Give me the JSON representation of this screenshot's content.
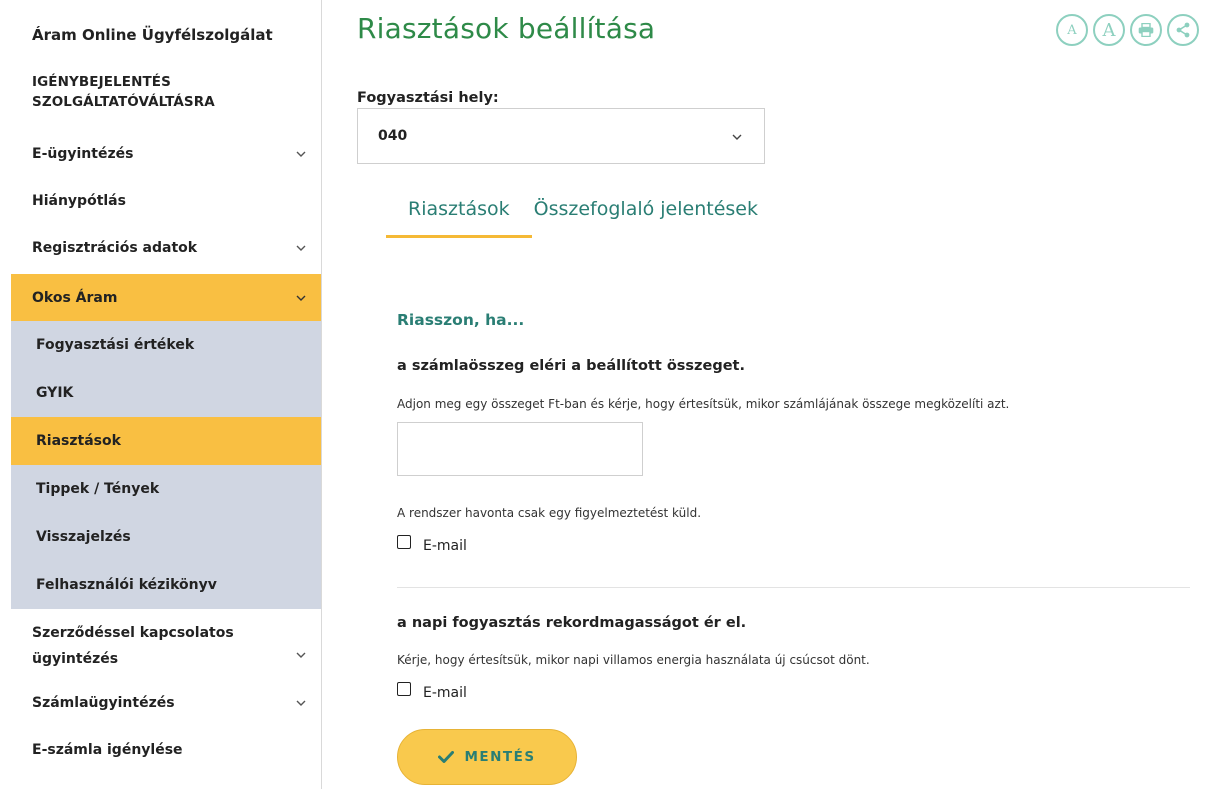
{
  "sidebar": {
    "title": "Áram Online Ügyfélszolgálat",
    "items": [
      {
        "label": "IGÉNYBEJELENTÉS SZOLGÁLTATÓVÁLTÁSRA"
      },
      {
        "label": "E-ügyintézés"
      },
      {
        "label": "Hiánypótlás"
      },
      {
        "label": "Regisztrációs adatok"
      },
      {
        "label": "Okos Áram"
      },
      {
        "label": "Fogyasztási értékek"
      },
      {
        "label": "GYIK"
      },
      {
        "label": "Riasztások"
      },
      {
        "label": "Tippek / Tények"
      },
      {
        "label": "Visszajelzés"
      },
      {
        "label": "Felhasználói kézikönyv"
      },
      {
        "label": "Szerződéssel kapcsolatos ügyintézés"
      },
      {
        "label": "Számlaügyintézés"
      },
      {
        "label": "E-számla igénylése"
      }
    ]
  },
  "page": {
    "title": "Riasztások beállítása"
  },
  "toolbar": {
    "small_a": "A",
    "big_a": "A"
  },
  "location": {
    "label": "Fogyasztási hely:",
    "value": "040"
  },
  "tabs": [
    {
      "label": "Riasztások",
      "active": true
    },
    {
      "label": "Összefoglaló jelentések",
      "active": false
    }
  ],
  "alerts": {
    "heading": "Riasszon, ha...",
    "bill": {
      "title": "a számlaösszeg eléri a beállított összeget.",
      "description": "Adjon meg egy összeget Ft-ban és kérje, hogy értesítsük, mikor számlájának összege megközelíti azt.",
      "amount_value": "",
      "note": "A rendszer havonta csak egy figyelmeztetést küld.",
      "email_label": "E-mail"
    },
    "record": {
      "title": "a napi fogyasztás rekordmagasságot ér el.",
      "description": "Kérje, hogy értesítsük, mikor napi villamos energia használata új csúcsot dönt.",
      "email_label": "E-mail"
    }
  },
  "save": {
    "label": "MENTÉS"
  },
  "colors": {
    "brand_green": "#2e8a48",
    "teal": "#2a7e74",
    "accent_yellow": "#f9bf42",
    "submenu_bg": "#d0d6e2"
  }
}
